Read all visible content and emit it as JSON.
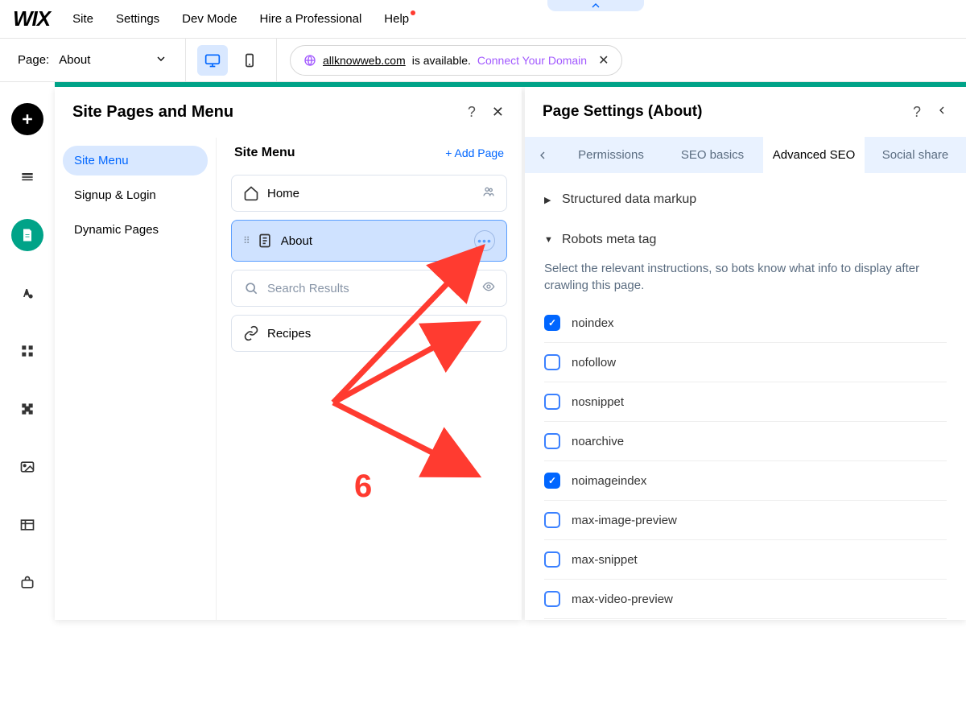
{
  "topnav": {
    "logo": "WIX",
    "items": [
      "Site",
      "Settings",
      "Dev Mode",
      "Hire a Professional",
      "Help"
    ]
  },
  "secondbar": {
    "page_label": "Page:",
    "page_name": "About",
    "domain_link": "allknowweb.com",
    "domain_available": "is available.",
    "domain_connect": "Connect Your Domain"
  },
  "pages_panel": {
    "title": "Site Pages and Menu",
    "sidebar": {
      "items": [
        {
          "label": "Site Menu",
          "active": true
        },
        {
          "label": "Signup & Login",
          "active": false
        },
        {
          "label": "Dynamic Pages",
          "active": false
        }
      ]
    },
    "list_title": "Site Menu",
    "add_page": "+ Add Page",
    "pages": [
      {
        "label": "Home",
        "icon": "home",
        "selected": false,
        "trailing": "members"
      },
      {
        "label": "About",
        "icon": "page",
        "selected": true,
        "trailing": "more"
      },
      {
        "label": "Search Results",
        "icon": "search",
        "selected": false,
        "trailing": "visible"
      },
      {
        "label": "Recipes",
        "icon": "link",
        "selected": false,
        "trailing": ""
      }
    ]
  },
  "settings_panel": {
    "title": "Page Settings (About)",
    "tabs": [
      "Permissions",
      "SEO basics",
      "Advanced SEO",
      "Social share"
    ],
    "active_tab": 2,
    "accordions": {
      "structured": "Structured data markup",
      "robots": "Robots meta tag"
    },
    "robots_description": "Select the relevant instructions, so bots know what info to display after crawling this page.",
    "checks": [
      {
        "label": "noindex",
        "checked": true
      },
      {
        "label": "nofollow",
        "checked": false
      },
      {
        "label": "nosnippet",
        "checked": false
      },
      {
        "label": "noarchive",
        "checked": false
      },
      {
        "label": "noimageindex",
        "checked": true
      },
      {
        "label": "max-image-preview",
        "checked": false
      },
      {
        "label": "max-snippet",
        "checked": false
      },
      {
        "label": "max-video-preview",
        "checked": false
      }
    ]
  },
  "annotation": {
    "label": "6"
  }
}
